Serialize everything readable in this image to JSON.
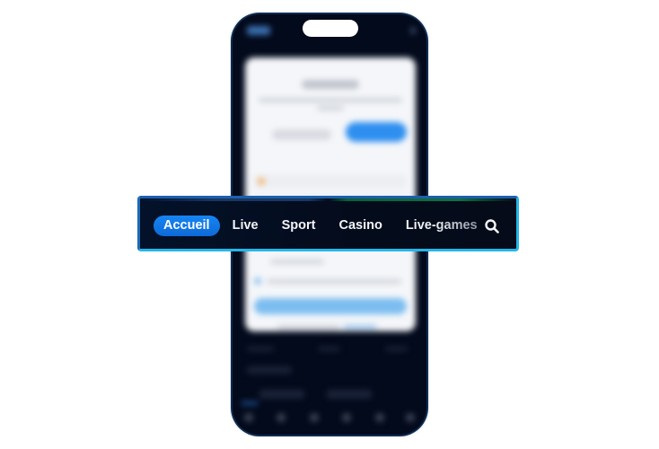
{
  "nav": {
    "items": [
      {
        "label": "Accueil",
        "active": true
      },
      {
        "label": "Live",
        "active": false
      },
      {
        "label": "Sport",
        "active": false
      },
      {
        "label": "Casino",
        "active": false
      },
      {
        "label": "Live-games",
        "active": false
      }
    ],
    "search_icon": "search-icon",
    "active_color": "#1685f2",
    "border_color": "#22b7ea"
  },
  "phone": {
    "background": "#030a1c",
    "card_background": "#f4f6f9",
    "accent": "#2e8ff0"
  }
}
